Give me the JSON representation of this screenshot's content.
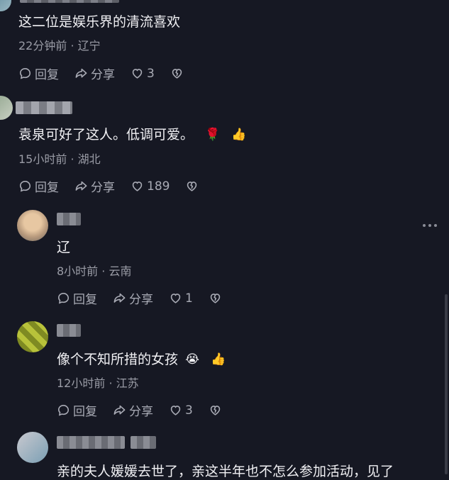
{
  "comments": [
    {
      "text": "这二位是娱乐界的清流喜欢",
      "time": "22分钟前",
      "location": "辽宁",
      "reply_label": "回复",
      "share_label": "分享",
      "likes": "3"
    },
    {
      "text": "袁泉可好了这人。低调可爱。",
      "emojis": [
        "🌹",
        "👍"
      ],
      "time": "15小时前",
      "location": "湖北",
      "reply_label": "回复",
      "share_label": "分享",
      "likes": "189"
    }
  ],
  "replies": [
    {
      "text": "辽",
      "time": "8小时前",
      "location": "云南",
      "reply_label": "回复",
      "share_label": "分享",
      "likes": "1"
    },
    {
      "text": "像个不知所措的女孩",
      "emojis": [
        "😭",
        "👍"
      ],
      "time": "12小时前",
      "location": "江苏",
      "reply_label": "回复",
      "share_label": "分享",
      "likes": "3"
    }
  ],
  "partial_comment": {
    "text": "亲的夫人媛媛去世了，亲这半年也不怎么参加活动，见了"
  },
  "separator": "·",
  "more_icon": "more-dots-icon",
  "icons": [
    "comment-icon",
    "share-icon",
    "heart-icon",
    "dislike-heart-icon",
    "more-dots-icon"
  ]
}
